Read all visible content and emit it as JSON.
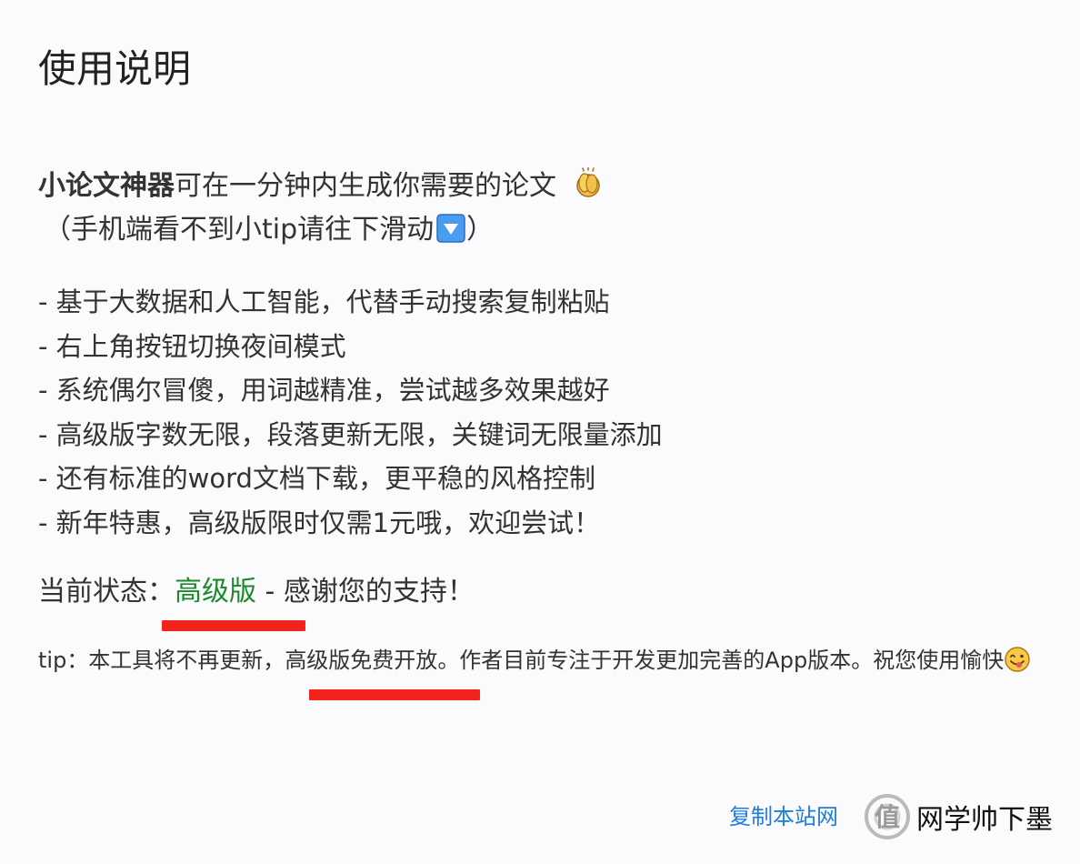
{
  "title": "使用说明",
  "intro": {
    "brand": "小论文神器",
    "text": "可在一分钟内生成你需要的论文",
    "icon": "clapping-hands-icon",
    "hint": "（手机端看不到小tip请往下滑动",
    "hint_icon": "down-arrow-icon",
    "hint_close": "）"
  },
  "features": [
    "- 基于大数据和人工智能，代替手动搜索复制粘贴",
    "- 右上角按钮切换夜间模式",
    "- 系统偶尔冒傻，用词越精准，尝试越多效果越好",
    "- 高级版字数无限，段落更新无限，关键词无限量添加",
    "- 还有标准的word文档下载，更平稳的风格控制",
    "- 新年特惠，高级版限时仅需1元哦，欢迎尝试！"
  ],
  "status": {
    "label": "当前状态：",
    "tier": "高级版",
    "thanks": " - 感谢您的支持！"
  },
  "tip": {
    "prefix": "tip：本工具将不再更新，",
    "highlight": "高级版免费开放",
    "suffix": "。作者目前专注于开发更加完善的App版本。祝您使用愉快",
    "icon": "tongue-smile-icon"
  },
  "footer": {
    "link": "复制本站网"
  },
  "watermark": {
    "text": "网学帅下墨",
    "brand": "什么值得买"
  },
  "colors": {
    "background": "#fbfafd",
    "text": "#333333",
    "tier_green": "#1b8a2c",
    "underline_red": "#f2231b",
    "link_blue": "#1e7ee0"
  }
}
